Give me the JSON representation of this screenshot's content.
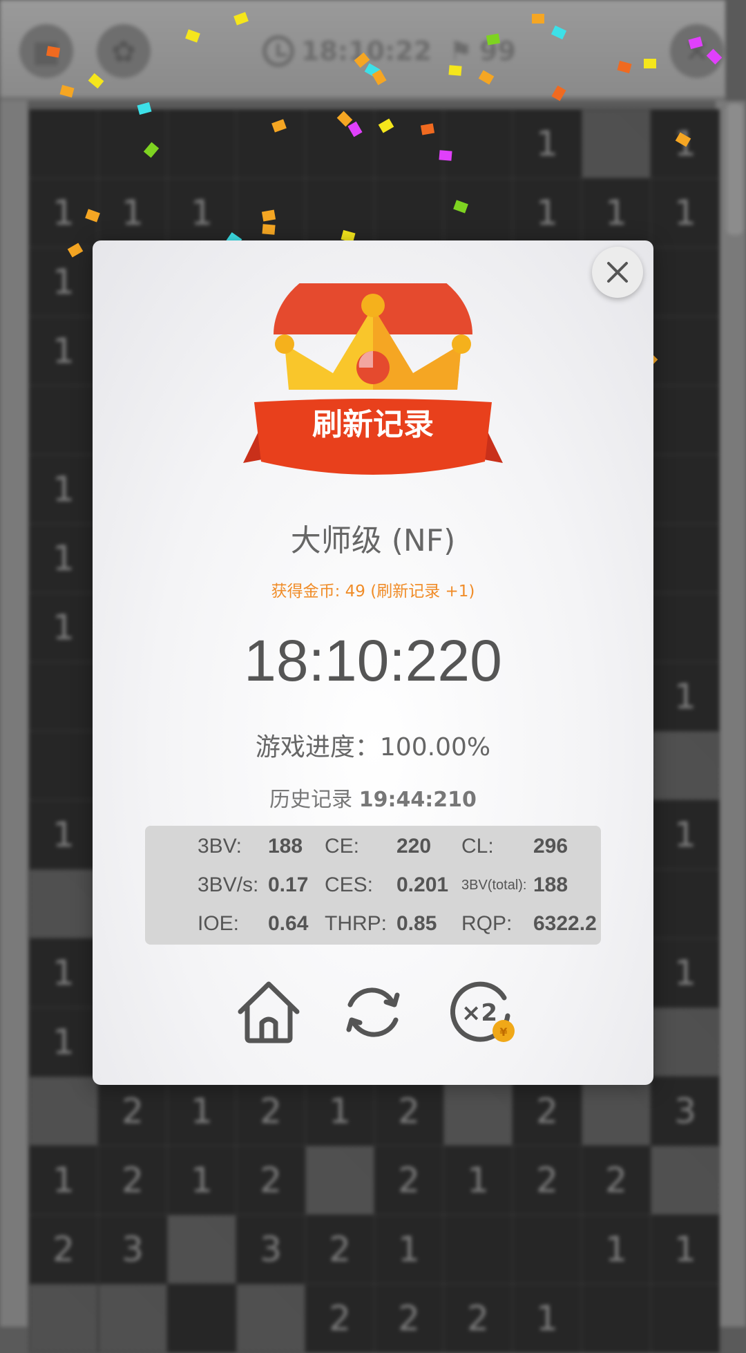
{
  "topbar": {
    "timer_text": "18:10:22",
    "flags_text": "99"
  },
  "board": {
    "rows": [
      [
        "",
        "",
        "",
        "",
        "",
        "",
        "",
        "1",
        "#",
        "1"
      ],
      [
        "1",
        "1",
        "1",
        "",
        "",
        "",
        "",
        "1",
        "1",
        "1"
      ],
      [
        "1",
        "",
        "",
        "",
        "",
        "",
        "",
        "",
        "",
        ""
      ],
      [
        "1",
        "",
        "",
        "",
        "",
        "",
        "",
        "",
        "",
        ""
      ],
      [
        "",
        "",
        "",
        "",
        "",
        "",
        "",
        "",
        "",
        ""
      ],
      [
        "1",
        "",
        "",
        "",
        "",
        "",
        "",
        "",
        "",
        ""
      ],
      [
        "1",
        "",
        "",
        "",
        "",
        "",
        "",
        "",
        "",
        ""
      ],
      [
        "1",
        "",
        "",
        "",
        "",
        "",
        "",
        "",
        "",
        ""
      ],
      [
        "",
        "",
        "",
        "",
        "",
        "",
        "",
        "",
        "",
        "1"
      ],
      [
        "",
        "",
        "",
        "",
        "",
        "",
        "",
        "",
        "",
        "#"
      ],
      [
        "1",
        "",
        "",
        "",
        "",
        "",
        "",
        "",
        "",
        "1"
      ],
      [
        "#",
        "",
        "",
        "",
        "",
        "",
        "",
        "",
        "",
        ""
      ],
      [
        "1",
        "",
        "",
        "",
        "",
        "",
        "",
        "",
        "",
        "1"
      ],
      [
        "1",
        "",
        "",
        "",
        "",
        "",
        "",
        "",
        "",
        "#"
      ],
      [
        "#",
        "2",
        "1",
        "2",
        "1",
        "2",
        "#",
        "2",
        "#",
        "3"
      ],
      [
        "1",
        "2",
        "1",
        "2",
        "#",
        "2",
        "1",
        "2",
        "2",
        "#"
      ],
      [
        "2",
        "3",
        "#",
        "3",
        "2",
        "1",
        "",
        "",
        "1",
        "1"
      ],
      [
        "#",
        "#",
        "",
        "#",
        "2",
        "2",
        "2",
        "1",
        "",
        ""
      ]
    ]
  },
  "dialog": {
    "banner": "刷新记录",
    "level": "大师级 (NF)",
    "coins": "获得金币: 49 (刷新记录 +1)",
    "time": "18:10:220",
    "progress": "游戏进度：100.00%",
    "history_label": "历史记录 ",
    "history_value": "19:44:210",
    "stats": [
      [
        {
          "label": "3BV:",
          "value": "188"
        },
        {
          "label": "CE:",
          "value": "220"
        },
        {
          "label": "CL:",
          "value": "296"
        }
      ],
      [
        {
          "label": "3BV/s:",
          "value": "0.17"
        },
        {
          "label": "CES:",
          "value": "0.201"
        },
        {
          "label": "3BV(total):",
          "value": "188"
        }
      ],
      [
        {
          "label": "IOE:",
          "value": "0.64"
        },
        {
          "label": "THRP:",
          "value": "0.85"
        },
        {
          "label": "RQP:",
          "value": "6322.2"
        }
      ]
    ],
    "double_label": "×2",
    "coin_symbol": "¥",
    "icons": {
      "close": "close-icon",
      "home": "home-icon",
      "restart": "restart-icon",
      "double": "double-coins-icon"
    }
  },
  "colors": {
    "banner_red": "#e8401c",
    "crown_yellow": "#f9c62b",
    "crown_orange": "#f5a623",
    "coin_gold": "#f0a818",
    "coins_text": "#f08c28",
    "icon_gray": "#555555"
  }
}
